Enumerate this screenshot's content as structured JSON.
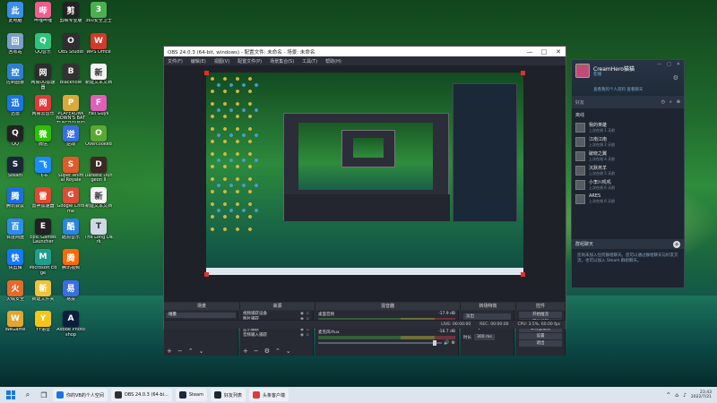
{
  "desktop_icons": [
    {
      "label": "此电脑",
      "icon": "computer-icon",
      "color": "#3a8ee6"
    },
    {
      "label": "回收站",
      "icon": "recycle-bin-icon",
      "color": "#7aa0c8"
    },
    {
      "label": "控制面板",
      "icon": "control-panel-icon",
      "color": "#2f7fd0"
    },
    {
      "label": "迅雷",
      "icon": "thunder-icon",
      "color": "#1a74e8"
    },
    {
      "label": "QQ",
      "icon": "qq-icon",
      "color": "#222222"
    },
    {
      "label": "Steam",
      "icon": "steam-icon",
      "color": "#1b2838"
    },
    {
      "label": "腾讯会议",
      "icon": "tencent-meeting-icon",
      "color": "#1c6fe0"
    },
    {
      "label": "百度网盘",
      "icon": "baidu-netdisk-icon",
      "color": "#2e8cf0"
    },
    {
      "label": "快剪辑",
      "icon": "quick-edit-icon",
      "color": "#1677ff"
    },
    {
      "label": "火绒安全",
      "icon": "huorong-icon",
      "color": "#e46b2a"
    },
    {
      "label": "WeGame",
      "icon": "wegame-icon",
      "color": "#e3a62d"
    },
    {
      "label": "哔哩哔哩",
      "icon": "bilibili-icon",
      "color": "#f25d8e"
    },
    {
      "label": "QQ音乐",
      "icon": "qq-music-icon",
      "color": "#31c27c"
    },
    {
      "label": "网易UU加速器",
      "icon": "uu-icon",
      "color": "#2d2d2d"
    },
    {
      "label": "网易云音乐",
      "icon": "netease-music-icon",
      "color": "#e03a3a"
    },
    {
      "label": "微信",
      "icon": "wechat-icon",
      "color": "#2dc100"
    },
    {
      "label": "飞书",
      "icon": "feishu-icon",
      "color": "#1a8cff"
    },
    {
      "label": "雷神加速器",
      "icon": "leishen-icon",
      "color": "#e2482e"
    },
    {
      "label": "Epic Games Launcher",
      "icon": "epic-icon",
      "color": "#222222"
    },
    {
      "label": "Microsoft Edge",
      "icon": "edge-icon",
      "color": "#1e9e8e"
    },
    {
      "label": "新建文件夹",
      "icon": "folder-icon",
      "color": "#f0c23a"
    },
    {
      "label": "YY语音",
      "icon": "yy-icon",
      "color": "#f5c518"
    },
    {
      "label": "剪映专业版",
      "icon": "jianying-icon",
      "color": "#222222"
    },
    {
      "label": "OBS Studio",
      "icon": "obs-icon",
      "color": "#302e31"
    },
    {
      "label": "Blackhole",
      "icon": "blackhole-icon",
      "color": "#333333"
    },
    {
      "label": "PLAYERUNKNOWN'S BATTLEGROUNDS",
      "icon": "pubg-icon",
      "color": "#d9a93a"
    },
    {
      "label": "逆战",
      "icon": "nizhan-icon",
      "color": "#3a6ee0"
    },
    {
      "label": "Super Animal Royale",
      "icon": "super-animal-icon",
      "color": "#e05a2a"
    },
    {
      "label": "Google Chrome",
      "icon": "chrome-icon",
      "color": "#dd4b39"
    },
    {
      "label": "酷狗音乐",
      "icon": "kugou-icon",
      "color": "#2a84e0"
    },
    {
      "label": "腾讯视频",
      "icon": "tencent-video-icon",
      "color": "#ff6a00"
    },
    {
      "label": "易投",
      "icon": "yitou-icon",
      "color": "#3a6ee0"
    },
    {
      "label": "Adobe Photoshop",
      "icon": "photoshop-icon",
      "color": "#0c1e3c"
    },
    {
      "label": "360安全卫士",
      "icon": "360-safe-icon",
      "color": "#4caf50"
    },
    {
      "label": "WPS Office",
      "icon": "wps-icon",
      "color": "#d23a2a"
    },
    {
      "label": "新建文本文档",
      "icon": "text-file-icon",
      "color": "#f4f4f4"
    },
    {
      "label": "Fall Guys",
      "icon": "fall-guys-icon",
      "color": "#e05fb8"
    },
    {
      "label": "Overcooked",
      "icon": "overcooked-icon",
      "color": "#5aa832"
    },
    {
      "label": "Darkest Dungeon II",
      "icon": "darkest-dungeon-icon",
      "color": "#3a2a22"
    },
    {
      "label": "新建文本文档",
      "icon": "text-file-icon",
      "color": "#f4f4f4"
    },
    {
      "label": "The Long Dark",
      "icon": "long-dark-icon",
      "color": "#d0d8e4"
    }
  ],
  "obs": {
    "title": "OBS 24.0.3 (64-bit, windows) - 配置文件: 未命名 - 场景: 未命名",
    "menu": [
      "文件(F)",
      "编辑(E)",
      "视图(V)",
      "配置文件(P)",
      "场景集合(S)",
      "工具(T)",
      "帮助(H)"
    ],
    "docks": {
      "scenes": "场景",
      "sources": "来源",
      "mixer": "混音器",
      "transitions": "转场特效",
      "controls": "控件"
    },
    "scene_items": [
      "场景"
    ],
    "sources": [
      "视频捕获设备",
      "图片捕获",
      "文本 (GDI+)",
      "显示捕获",
      "音频输入捕获"
    ],
    "mixer_channels": [
      {
        "name": "桌面音频",
        "db": "-17.9 dB"
      },
      {
        "name": "麦克风/Aux",
        "db": "-16.7 dB"
      }
    ],
    "transition_select": "淡出",
    "duration_label": "时长",
    "duration_value": "300 ms",
    "control_buttons": [
      "开始推流",
      "开始录制",
      "工作室模式",
      "设置",
      "退出"
    ],
    "status": {
      "live": "LIVE: 00:00:00",
      "rec": "REC: 00:00:00",
      "cpu": "CPU: 3.5%, 60.00 fps"
    }
  },
  "steam": {
    "user_name": "CreamHero猫猫",
    "user_status": "在线",
    "user_sub": "查看我的个人资料 查看聊天",
    "search_label": "好友",
    "group_label": "离线",
    "friends": [
      {
        "name": "我的英雄",
        "status": "上次在线 1 天前"
      },
      {
        "name": "江南江南",
        "status": "上次在线 2 天前"
      },
      {
        "name": "破晓之翼",
        "status": "上次在线 4 天前"
      },
      {
        "name": "沉默羔羊",
        "status": "上次在线 5 天前"
      },
      {
        "name": "小李川叽叽",
        "status": "上次在线 6 天前"
      },
      {
        "name": "ARES",
        "status": "上次在线 6 天前"
      }
    ],
    "chat_header": "群组聊天",
    "chat_text": "您尚未加入任何群组聊天。您可以通过群组聊天与好友交流，也可以加入 Steam 群组聊天。"
  },
  "taskbar": {
    "apps": [
      {
        "label": "你的VB的个人空间",
        "color": "#1a74e8"
      },
      {
        "label": "OBS 24.0.3 (64-bi...",
        "color": "#302e31"
      },
      {
        "label": "Steam",
        "color": "#1b2838"
      },
      {
        "label": "好友列表",
        "color": "#1b2838"
      },
      {
        "label": "头条客户端",
        "color": "#e03a3a"
      }
    ],
    "time": "23:43",
    "date": "2022/7/21"
  }
}
